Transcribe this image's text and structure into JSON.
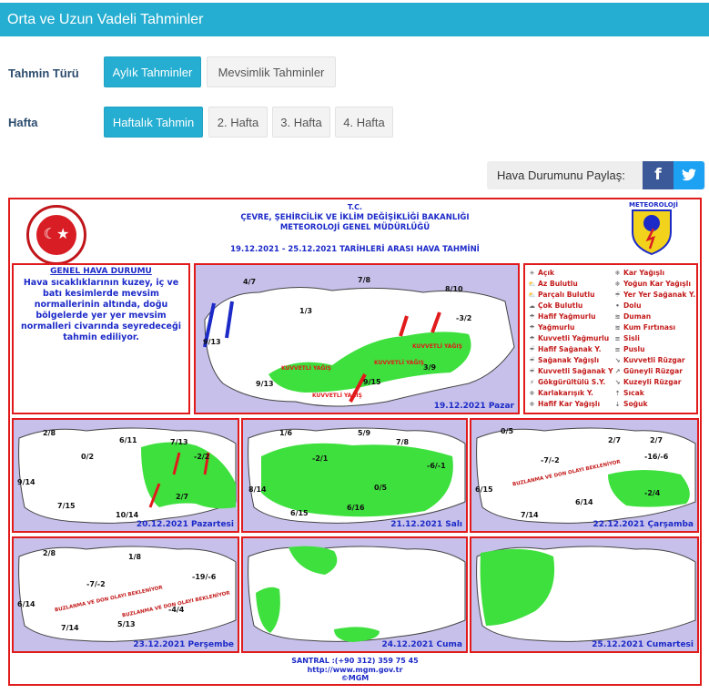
{
  "header": {
    "title": "Orta ve Uzun Vadeli Tahminler"
  },
  "forecast_type": {
    "label": "Tahmin Türü",
    "options": [
      "Aylık Tahminler",
      "Mevsimlik Tahminler"
    ],
    "selected": "Aylık Tahminler"
  },
  "week": {
    "label": "Hafta",
    "options": [
      "Haftalık Tahmin",
      "2. Hafta",
      "3. Hafta",
      "4. Hafta"
    ],
    "selected": "Haftalık Tahmin"
  },
  "share": {
    "label": "Hava Durumunu Paylaş:",
    "facebook": "f",
    "twitter": "t"
  },
  "bulletin": {
    "org_line1": "T.C.",
    "org_line2": "ÇEVRE, ŞEHİRCİLİK VE İKLİM DEĞİŞİKLİĞİ BAKANLIĞI",
    "org_line3": "METEOROLOJİ  GENEL  MÜDÜRLÜĞÜ",
    "date_range": "19.12.2021  -  25.12.2021    TARİHLERİ ARASI HAVA TAHMİNİ",
    "logo_text": "METEOROLOJİ",
    "general_title": "GENEL HAVA DURUMU",
    "general_text": "Hava sıcaklıklarının kuzey, iç ve batı kesimlerde mevsim normallerinin altında, doğu bölgelerde yer yer mevsim normalleri civarında seyredeceği tahmin ediliyor.",
    "footer_phone": "SANTRAL :(+90 312) 359 75 45",
    "footer_url": "http://www.mgm.gov.tr",
    "footer_copy": "©MGM"
  },
  "legend": {
    "col1": [
      "Açık",
      "Az Bulutlu",
      "Parçalı Bulutlu",
      "Çok Bulutlu",
      "Hafif Yağmurlu",
      "Yağmurlu",
      "Kuvvetli Yağmurlu",
      "Hafif Sağanak Y.",
      "Sağanak Yağışlı",
      "Kuvvetli Sağanak Y",
      "Gökgürültülü S.Y.",
      "Karlakarışık Y.",
      "Hafif Kar Yağışlı"
    ],
    "col2": [
      "Kar Yağışlı",
      "Yoğun Kar Yağışlı",
      "Yer Yer Sağanak Y.",
      "Dolu",
      "Duman",
      "Kum Fırtınası",
      "Sisli",
      "Puslu",
      "Kuvvetli Rüzgar",
      "Güneyli Rüzgar",
      "Kuzeyli Rüzgar",
      "Sıcak",
      "Soğuk"
    ]
  },
  "panels": {
    "main": {
      "date": "19.12.2021 Pazar",
      "temps": [
        "4/7",
        "7/8",
        "8/10",
        "1/3",
        "-3/2",
        "9/13",
        "3/9",
        "9/13",
        "9/15"
      ],
      "labels": [
        "KUVVETLİ YAĞIŞ",
        "KUVVETLİ YAĞIŞ",
        "KUVVETLİ YAĞIŞ",
        "KUVVETLİ YAĞIŞ"
      ]
    },
    "d20": {
      "date": "20.12.2021 Pazartesi",
      "temps": [
        "2/8",
        "6/11",
        "7/13",
        "0/2",
        "-2/2",
        "9/14",
        "7/15",
        "2/7",
        "10/14"
      ]
    },
    "d21": {
      "date": "21.12.2021 Salı",
      "temps": [
        "1/6",
        "5/9",
        "7/8",
        "-2/1",
        "-6/-1",
        "8/14",
        "0/5",
        "6/15",
        "6/16"
      ]
    },
    "d22": {
      "date": "22.12.2021 Çarşamba",
      "temps": [
        "0/5",
        "2/7",
        "2/7",
        "-7/-2",
        "-16/-6",
        "6/15",
        "-2/4",
        "6/14",
        "7/14"
      ],
      "labels": [
        "BUZLANMA VE DON OLAYI BEKLENİYOR"
      ]
    },
    "d23": {
      "date": "23.12.2021 Perşembe",
      "temps": [
        "2/8",
        "1/8",
        "-7/-2",
        "-19/-6",
        "6/14",
        "-4/4",
        "5/13",
        "7/14"
      ],
      "labels": [
        "BUZLANMA VE DON OLAYI BEKLENİYOR",
        "BUZLANMA VE DON OLAYI BEKLENİYOR"
      ]
    },
    "d24": {
      "date": "24.12.2021 Cuma"
    },
    "d25": {
      "date": "25.12.2021 Cumartesi"
    }
  }
}
